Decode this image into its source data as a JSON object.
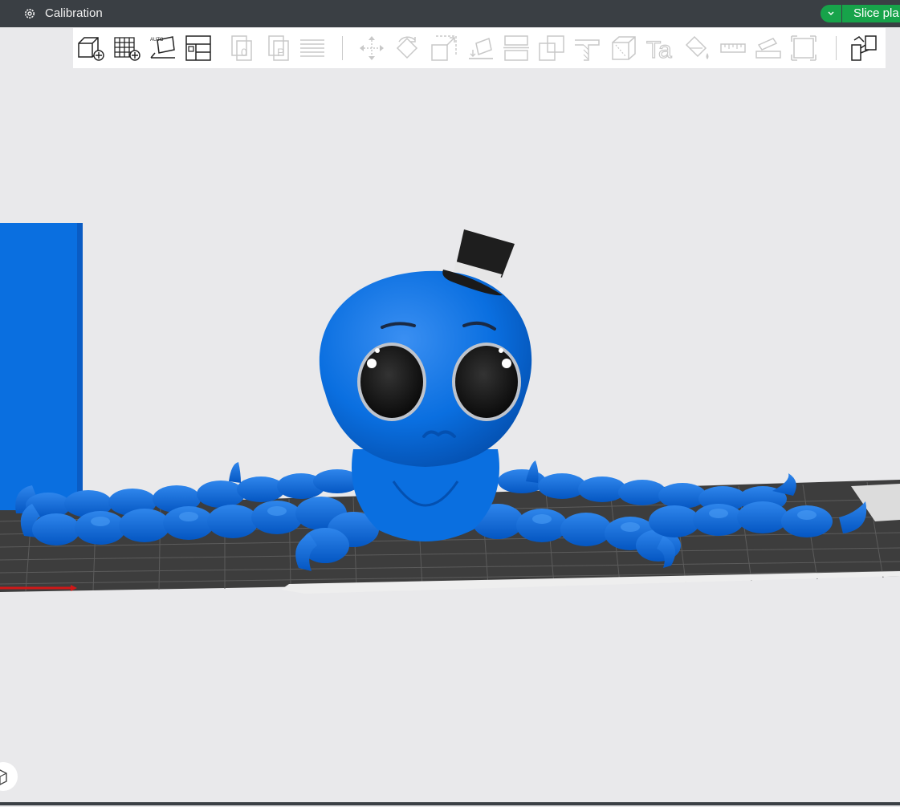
{
  "window": {
    "title": "Calibration"
  },
  "actions": {
    "slice_label": "Slice pla"
  },
  "toolbar": {
    "tools": [
      "add-cube-icon",
      "add-plate-icon",
      "auto-orient-icon",
      "arrange-icon",
      "copy-icon",
      "paste-icon",
      "layers-icon",
      "move-icon",
      "rotate-icon",
      "scale-icon",
      "lay-flat-icon",
      "cut-icon",
      "boolean-icon",
      "support-paint-icon",
      "seam-paint-icon",
      "text-icon",
      "color-paint-icon",
      "measure-icon",
      "assembly-icon",
      "fullscreen-icon",
      "split-icon"
    ],
    "auto_label": "AUTO",
    "copy_letter": "0",
    "paste_letter": "P",
    "text_letter": "Ta"
  },
  "colors": {
    "titlebar": "#3a3f44",
    "accent": "#17a34a",
    "model_blue": "#0a6fe0",
    "canvas": "#e9e9eb"
  }
}
